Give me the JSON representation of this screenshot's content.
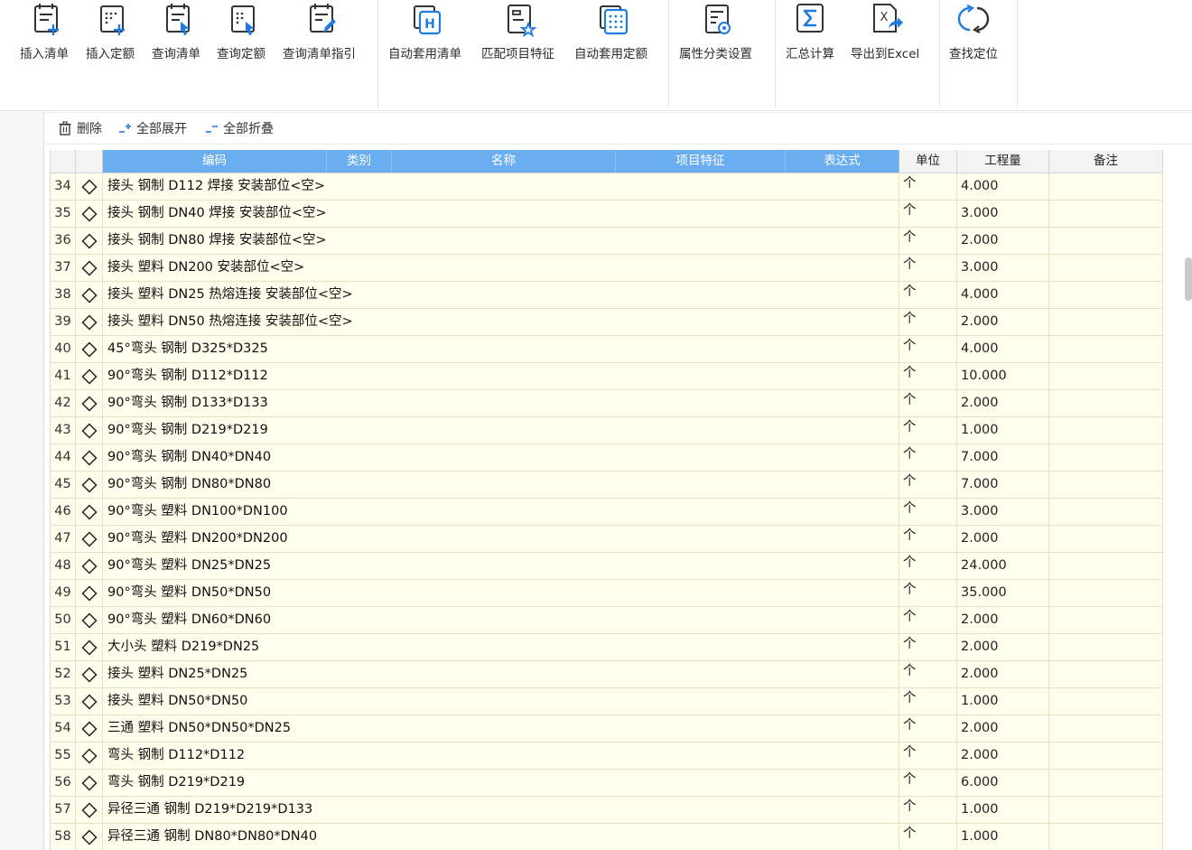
{
  "ribbon": {
    "buttons": [
      {
        "label": "插入清单",
        "icon": "insert-list-icon"
      },
      {
        "label": "插入定额",
        "icon": "insert-quota-icon"
      },
      {
        "label": "查询清单",
        "icon": "query-list-icon"
      },
      {
        "label": "查询定额",
        "icon": "query-quota-icon"
      },
      {
        "label": "查询清单指引",
        "icon": "query-guide-icon"
      },
      {
        "label": "自动套用清单",
        "icon": "auto-apply-list-icon"
      },
      {
        "label": "匹配项目特征",
        "icon": "match-feature-icon"
      },
      {
        "label": "自动套用定额",
        "icon": "auto-apply-quota-icon"
      },
      {
        "label": "属性分类设置",
        "icon": "property-settings-icon"
      },
      {
        "label": "汇总计算",
        "icon": "sum-icon"
      },
      {
        "label": "导出到Excel",
        "icon": "export-excel-icon"
      },
      {
        "label": "查找定位",
        "icon": "find-locate-icon"
      }
    ]
  },
  "subtoolbar": {
    "delete_label": "删除",
    "expand_label": "全部展开",
    "collapse_label": "全部折叠"
  },
  "grid": {
    "headers": {
      "code": "编码",
      "category": "类别",
      "name": "名称",
      "feature": "项目特征",
      "expression": "表达式",
      "unit": "单位",
      "quantity": "工程量",
      "note": "备注"
    },
    "rows": [
      {
        "no": "34",
        "name": "接头 钢制 D112 焊接 安装部位<空>",
        "unit": "个",
        "qty": "4.000",
        "marked": false
      },
      {
        "no": "35",
        "name": "接头 钢制 DN40 焊接 安装部位<空>",
        "unit": "个",
        "qty": "3.000",
        "marked": false
      },
      {
        "no": "36",
        "name": "接头 钢制 DN80 焊接 安装部位<空>",
        "unit": "个",
        "qty": "2.000",
        "marked": false
      },
      {
        "no": "37",
        "name": "接头 塑料 DN200 安装部位<空>",
        "unit": "个",
        "qty": "3.000",
        "marked": false
      },
      {
        "no": "38",
        "name": "接头 塑料 DN25 热熔连接 安装部位<空>",
        "unit": "个",
        "qty": "4.000",
        "marked": false
      },
      {
        "no": "39",
        "name": "接头 塑料 DN50 热熔连接 安装部位<空>",
        "unit": "个",
        "qty": "2.000",
        "marked": false
      },
      {
        "no": "40",
        "name": "45°弯头 钢制 D325*D325",
        "unit": "个",
        "qty": "4.000",
        "marked": false
      },
      {
        "no": "41",
        "name": "90°弯头 钢制 D112*D112",
        "unit": "个",
        "qty": "10.000",
        "marked": false
      },
      {
        "no": "42",
        "name": "90°弯头 钢制 D133*D133",
        "unit": "个",
        "qty": "2.000",
        "marked": false
      },
      {
        "no": "43",
        "name": "90°弯头 钢制 D219*D219",
        "unit": "个",
        "qty": "1.000",
        "marked": false
      },
      {
        "no": "44",
        "name": "90°弯头 钢制 DN40*DN40",
        "unit": "个",
        "qty": "7.000",
        "marked": true
      },
      {
        "no": "45",
        "name": "90°弯头 钢制 DN80*DN80",
        "unit": "个",
        "qty": "7.000",
        "marked": true
      },
      {
        "no": "46",
        "name": "90°弯头 塑料 DN100*DN100",
        "unit": "个",
        "qty": "3.000",
        "marked": true
      },
      {
        "no": "47",
        "name": "90°弯头 塑料 DN200*DN200",
        "unit": "个",
        "qty": "2.000",
        "marked": true
      },
      {
        "no": "48",
        "name": "90°弯头 塑料 DN25*DN25",
        "unit": "个",
        "qty": "24.000",
        "marked": false
      },
      {
        "no": "49",
        "name": "90°弯头 塑料 DN50*DN50",
        "unit": "个",
        "qty": "35.000",
        "marked": false
      },
      {
        "no": "50",
        "name": "90°弯头 塑料 DN60*DN60",
        "unit": "个",
        "qty": "2.000",
        "marked": false
      },
      {
        "no": "51",
        "name": "大小头 塑料 D219*DN25",
        "unit": "个",
        "qty": "2.000",
        "marked": false
      },
      {
        "no": "52",
        "name": "接头 塑料 DN25*DN25",
        "unit": "个",
        "qty": "2.000",
        "marked": false
      },
      {
        "no": "53",
        "name": "接头 塑料 DN50*DN50",
        "unit": "个",
        "qty": "1.000",
        "marked": false
      },
      {
        "no": "54",
        "name": "三通 塑料 DN50*DN50*DN25",
        "unit": "个",
        "qty": "2.000",
        "marked": false
      },
      {
        "no": "55",
        "name": "弯头 钢制 D112*D112",
        "unit": "个",
        "qty": "2.000",
        "marked": false
      },
      {
        "no": "56",
        "name": "弯头 钢制 D219*D219",
        "unit": "个",
        "qty": "6.000",
        "marked": false
      },
      {
        "no": "57",
        "name": "异径三通 钢制 D219*D219*D133",
        "unit": "个",
        "qty": "1.000",
        "marked": false
      },
      {
        "no": "58",
        "name": "异径三通 钢制 DN80*DN80*DN40",
        "unit": "个",
        "qty": "1.000",
        "marked": false
      }
    ]
  }
}
